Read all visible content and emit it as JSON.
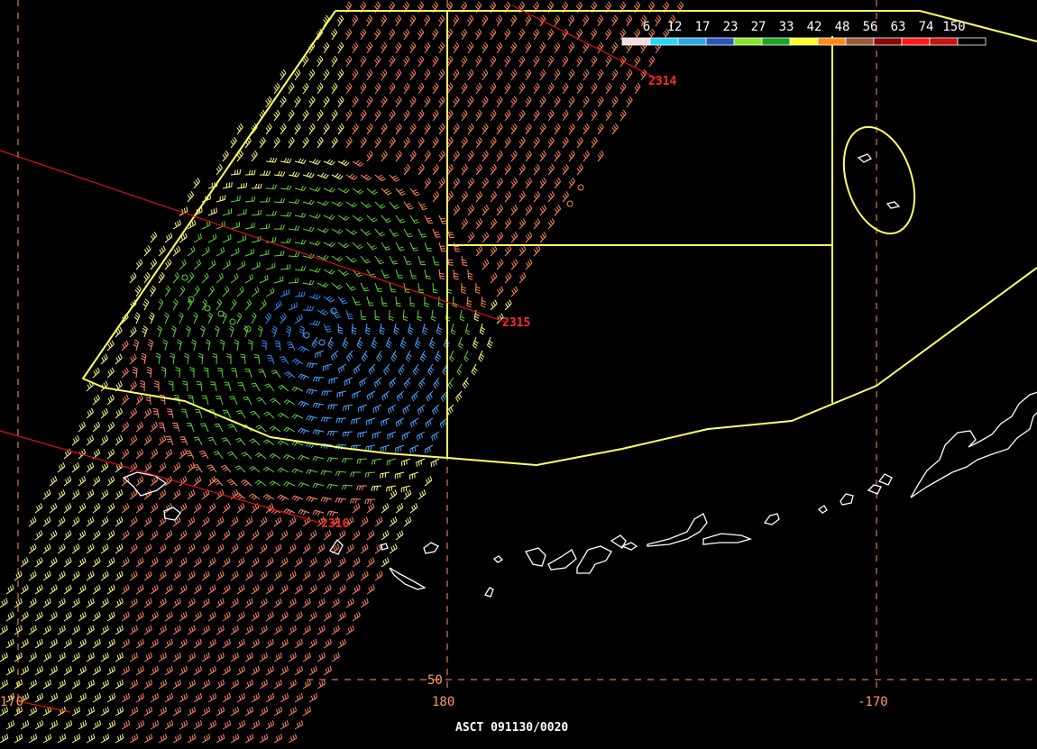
{
  "title": "ASCT 091130/0020",
  "legend": {
    "labels": [
      "6",
      "12",
      "17",
      "23",
      "27",
      "33",
      "42",
      "48",
      "56",
      "63",
      "74",
      "150"
    ],
    "colors": [
      "#f3dedd",
      "#2ad6f5",
      "#2aa6e6",
      "#2b55b8",
      "#88e62a",
      "#21a321",
      "#ffff2a",
      "#ff8a1a",
      "#9a5c3a",
      "#8a0a0a",
      "#ff1a1a",
      "#cc1111",
      "#000000"
    ]
  },
  "grid_labels": {
    "lon_180": "180",
    "lon_m170": "-170",
    "lon_170_left": "170",
    "lat_50": "50"
  },
  "pass_times": [
    "2314",
    "2315",
    "2316"
  ],
  "colors": {
    "background": "#000000",
    "grid": "#ff9a5c",
    "boundary": "#ffff66",
    "coast": "#ffffff",
    "pass_line": "#dd1111"
  }
}
